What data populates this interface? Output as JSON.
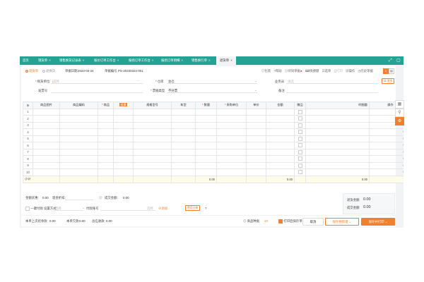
{
  "tabs": [
    {
      "label": "首页",
      "active": false
    },
    {
      "label": "销货单",
      "active": false
    },
    {
      "label": "销售换货记录表",
      "active": false
    },
    {
      "label": "报价订单工作台",
      "active": false
    },
    {
      "label": "报损订单工作台",
      "active": false
    },
    {
      "label": "报损订单明细",
      "active": false
    },
    {
      "label": "销售换行单",
      "active": false
    },
    {
      "label": "退货单",
      "active": true
    }
  ],
  "header": {
    "type_sales_return": "退货单",
    "type_exchange": "退换货",
    "date_label": "单据日期",
    "date_value": "2023-03-24",
    "docno_label": "单据编号",
    "docno_value": "PS-20230324-001",
    "tools": [
      "包装",
      "帮助",
      "待同单据",
      "快捷键",
      "选单",
      "打印",
      "操作",
      "历史单据"
    ]
  },
  "form": {
    "customer_label": "购货单位",
    "customer_placeholder": "选择",
    "warehouse_label": "仓库",
    "warehouse_value": "总仓",
    "salesman_label": "业务员",
    "salesman_placeholder": "请选",
    "advanced_btn": "高 更多",
    "invoice_label": "发票号",
    "invoice_type_label": "票据类型",
    "invoice_type_value": "不开票",
    "remark_label": "备注"
  },
  "grid": {
    "columns": [
      "",
      "商品图片",
      "商品编码",
      "商品",
      "",
      "规格型号",
      "车型",
      "数量",
      "采购单位",
      "单价",
      "金额",
      "赠品",
      "明细量",
      "操作"
    ],
    "batch_label": "批量",
    "rows": [
      "1",
      "2",
      "3",
      "4",
      "5",
      "6",
      "7",
      "8",
      "9",
      "10"
    ],
    "total_label": "小计",
    "total_qty": "0.00",
    "total_amount": "0.00",
    "total_detail": "0.00"
  },
  "summary": {
    "discount_label": "金额优惠:",
    "discount_value": "0.00",
    "paid_label": "现金折扣:",
    "deal_label": "成交金额:",
    "deal_value": "0.00",
    "refund_label": "一键付款 设置方式",
    "refund_placeholder": "选择",
    "account_label": "付款账号",
    "account_placeholder": "选择",
    "add_label": "添加",
    "extra_btn": "费用分摊",
    "box_total_label": "退货金额",
    "box_total_value": "0.00",
    "box_deal_label": "成交金额",
    "box_deal_value": "0.00"
  },
  "footer": {
    "balance_label": "本单上次结余款",
    "balance_value": "0.00",
    "due_label": "本单欠款",
    "due_value": "0.00",
    "total_due_label": "总应收款",
    "total_due_value": "0.00",
    "goods_count_label": "商品种类",
    "goods_count_value": "10",
    "print_check_label": "打印后保存单据",
    "btn_cancel": "取消",
    "btn_save_add": "保存并新增",
    "btn_save_print": "保存并打印"
  },
  "colors": {
    "brand": "#24a394",
    "accent": "#f07f2e"
  }
}
